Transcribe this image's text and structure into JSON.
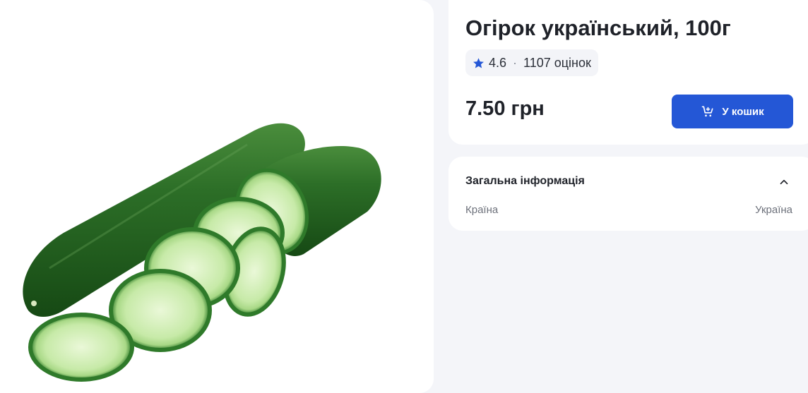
{
  "product": {
    "title": "Огірок український, 100г",
    "image_alt": "cucumber-image"
  },
  "rating": {
    "score": "4.6",
    "separator": "·",
    "count_text": "1107 оцінок"
  },
  "price": {
    "text": "7.50 грн"
  },
  "cart_button": {
    "label": "У кошик",
    "icon": "cart-plus-icon"
  },
  "info": {
    "title": "Загальна інформація",
    "toggle_icon": "chevron-up-icon",
    "rows": [
      {
        "label": "Країна",
        "value": "Україна"
      }
    ]
  },
  "colors": {
    "accent": "#2457d6",
    "panel_bg": "#f4f5f9",
    "card_bg": "#ffffff",
    "cucumber_dark": "#1e5a1c",
    "cucumber_slice": "#c9ecb0"
  }
}
